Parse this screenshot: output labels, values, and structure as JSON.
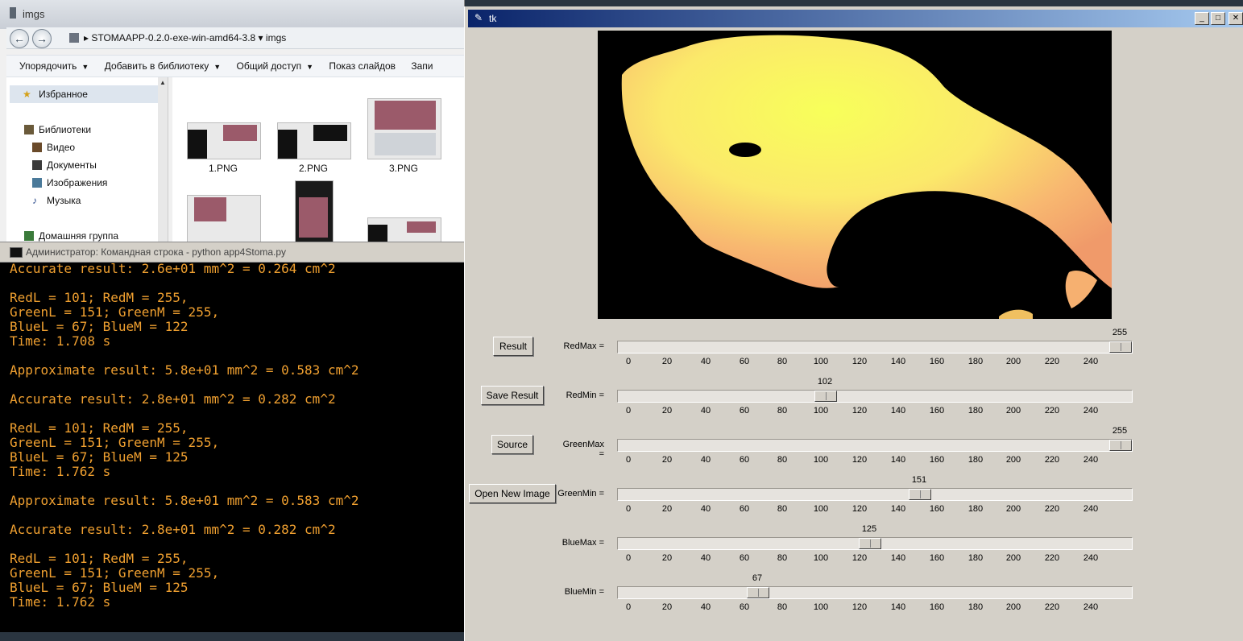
{
  "explorer": {
    "title": "imgs",
    "breadcrumb": [
      "STOMAAPP-0.2.0-exe-win-amd64-3.8",
      "imgs"
    ],
    "toolbar": [
      "Упорядочить",
      "Добавить в библиотеку",
      "Общий доступ",
      "Показ слайдов",
      "Запи"
    ],
    "nav": {
      "favorites": "Избранное",
      "libraries": "Библиотеки",
      "video": "Видео",
      "documents": "Документы",
      "images": "Изображения",
      "music": "Музыка",
      "homegroup": "Домашняя группа"
    },
    "files": [
      "1.PNG",
      "2.PNG",
      "3.PNG"
    ]
  },
  "console": {
    "title": "Администратор: Командная строка - python  app4Stoma.py",
    "lines": [
      "Accurate result: 2.6e+01 mm^2 = 0.264 cm^2",
      "",
      "RedL = 101; RedM = 255,",
      "GreenL = 151; GreenM = 255,",
      "BlueL = 67; BlueM = 122",
      "Time: 1.708 s",
      "",
      "Approximate result: 5.8e+01 mm^2 = 0.583 cm^2",
      "",
      "Accurate result: 2.8e+01 mm^2 = 0.282 cm^2",
      "",
      "RedL = 101; RedM = 255,",
      "GreenL = 151; GreenM = 255,",
      "BlueL = 67; BlueM = 125",
      "Time: 1.762 s",
      "",
      "Approximate result: 5.8e+01 mm^2 = 0.583 cm^2",
      "",
      "Accurate result: 2.8e+01 mm^2 = 0.282 cm^2",
      "",
      "RedL = 101; RedM = 255,",
      "GreenL = 151; GreenM = 255,",
      "BlueL = 67; BlueM = 125",
      "Time: 1.762 s"
    ]
  },
  "tk": {
    "title": "tk",
    "buttons": {
      "result": "Result",
      "save_result": "Save Result",
      "source": "Source",
      "open_new_image": "Open New Image"
    },
    "slider_range": [
      0,
      255
    ],
    "tick_labels": [
      "0",
      "20",
      "40",
      "60",
      "80",
      "100",
      "120",
      "140",
      "160",
      "180",
      "200",
      "220",
      "240"
    ],
    "sliders": [
      {
        "label": "RedMax =",
        "value": 255
      },
      {
        "label": "RedMin =",
        "value": 102
      },
      {
        "label": "GreenMax =",
        "value": 255
      },
      {
        "label": "GreenMin =",
        "value": 151
      },
      {
        "label": "BlueMax =",
        "value": 125
      },
      {
        "label": "BlueMin =",
        "value": 67
      }
    ]
  }
}
